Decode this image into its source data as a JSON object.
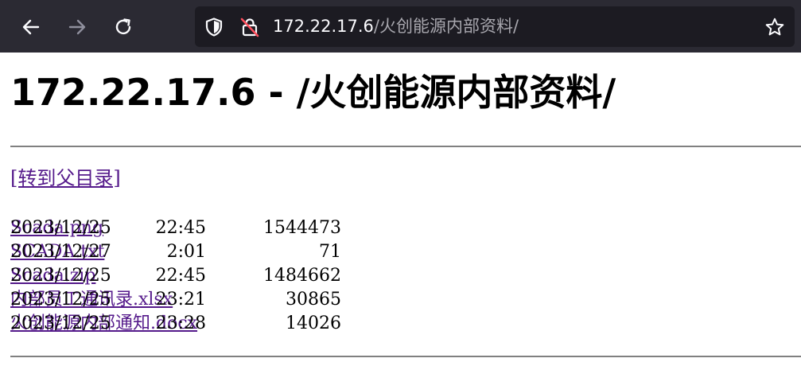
{
  "browser": {
    "back_icon": "back-arrow-icon",
    "forward_icon": "forward-arrow-icon",
    "reload_icon": "reload-icon",
    "shield_icon": "shield-icon",
    "insecure_icon": "insecure-lock-icon",
    "star_icon": "star-icon",
    "url_host": "172.22.17.6",
    "url_path": "/火创能源内部资料/"
  },
  "page": {
    "title": "172.22.17.6 - /火创能源内部资料/",
    "parent_link": "[转到父目录]",
    "files": [
      {
        "date": "2023/12/25",
        "time": "22:45",
        "size": "1544473",
        "name": "Scada.png"
      },
      {
        "date": "2023/12/27",
        "time": "2:01",
        "size": "71",
        "name": "SCADA.txt"
      },
      {
        "date": "2023/12/25",
        "time": "22:45",
        "size": "1484662",
        "name": "Scada.zip"
      },
      {
        "date": "2023/12/25",
        "time": "23:21",
        "size": "30865",
        "name": "内部员工通讯录.xlsx"
      },
      {
        "date": "2023/12/25",
        "time": "23:28",
        "size": "14026",
        "name": "火创能源内部通知.docx"
      }
    ]
  },
  "colors": {
    "toolbar_bg": "#2b2a33",
    "urlbar_bg": "#1c1b22",
    "link_visited": "#551a8b",
    "rule": "#808080"
  }
}
